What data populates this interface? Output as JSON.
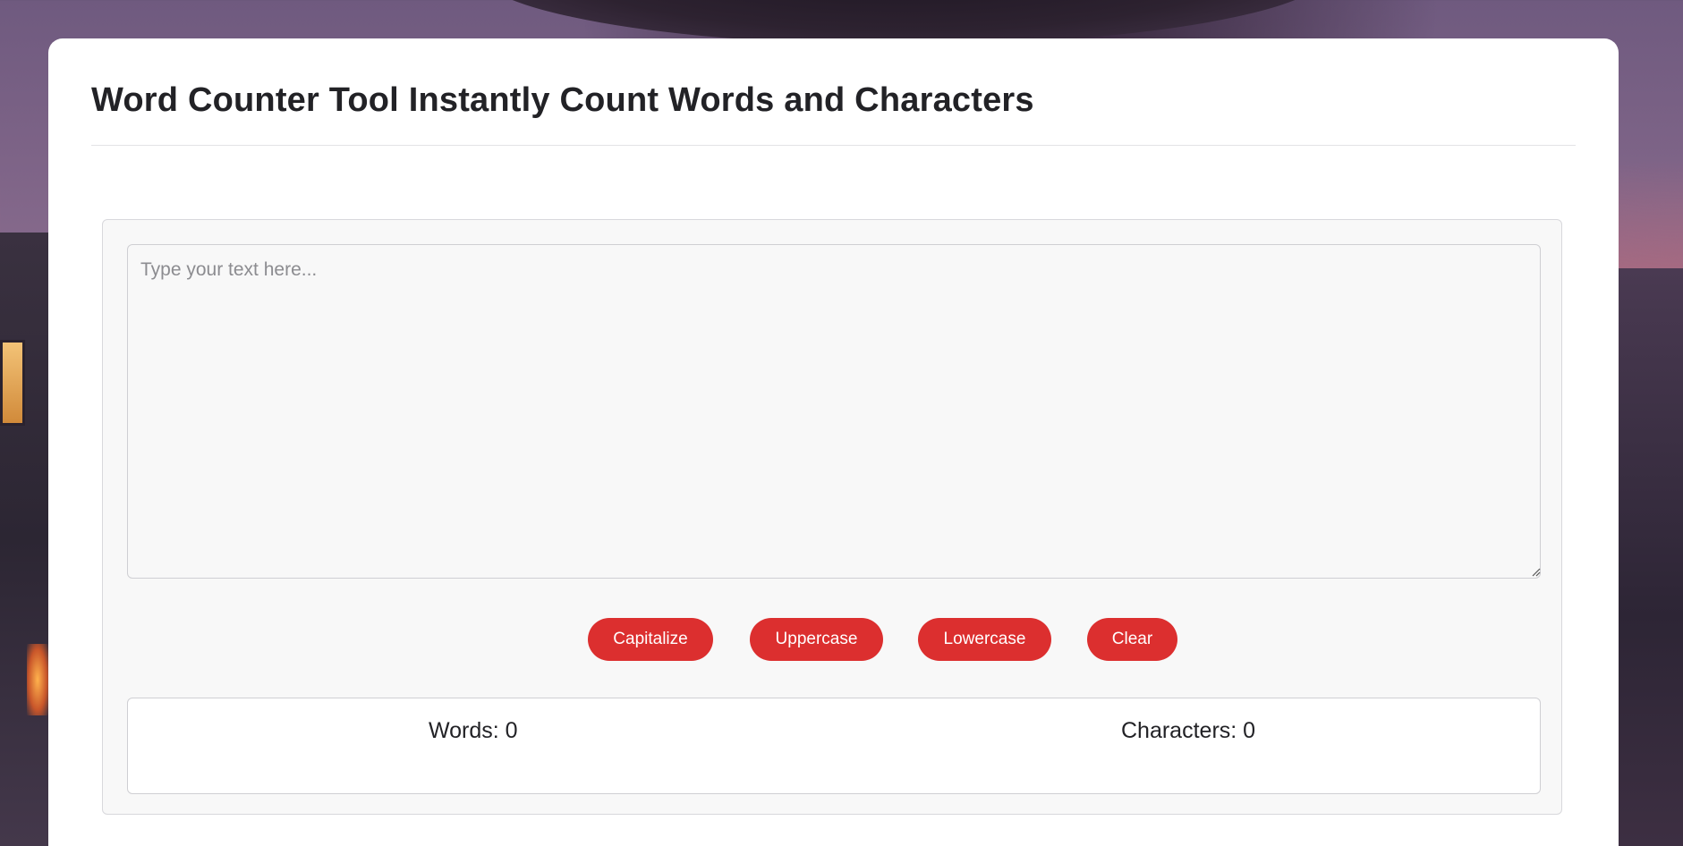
{
  "page": {
    "title": "Word Counter Tool Instantly Count Words and Characters"
  },
  "editor": {
    "placeholder": "Type your text here...",
    "value": ""
  },
  "actions": {
    "capitalize_label": "Capitalize",
    "uppercase_label": "Uppercase",
    "lowercase_label": "Lowercase",
    "clear_label": "Clear"
  },
  "stats": {
    "words_text": "Words: 0",
    "characters_text": "Characters: 0"
  },
  "colors": {
    "accent": "#dc2f2f",
    "title_text": "#222226",
    "panel_bg": "#f8f8f8",
    "card_bg": "#ffffff"
  }
}
